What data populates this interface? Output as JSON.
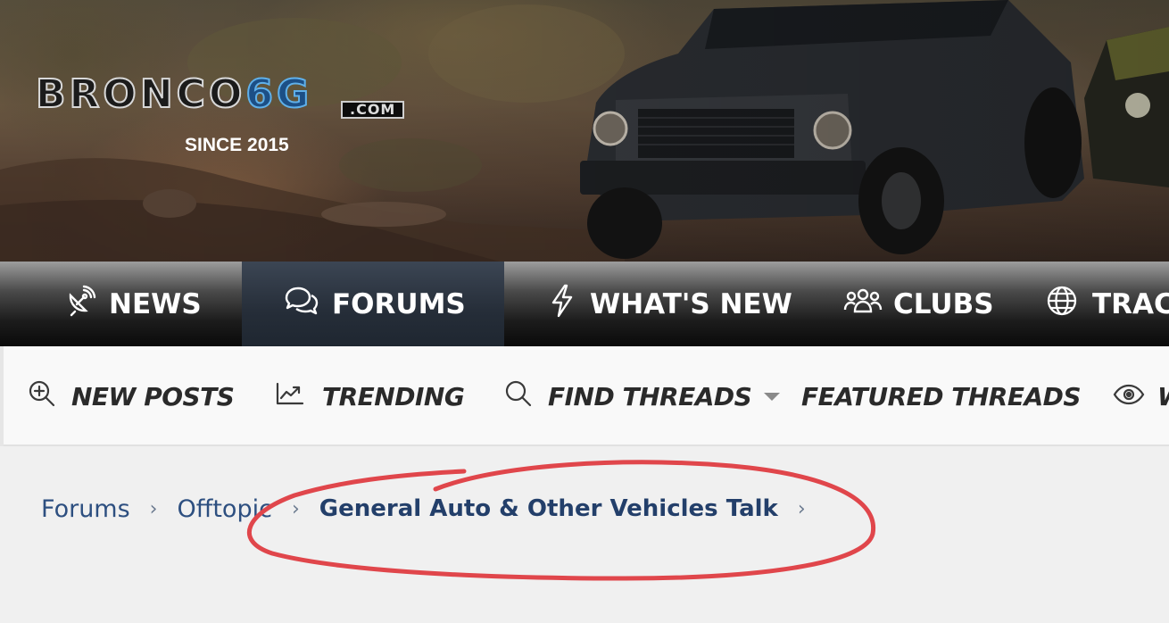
{
  "banner": {
    "logo_main": "BRONCO",
    "logo_six": "6G",
    "logo_com": ".COM",
    "tagline": "SINCE 2015"
  },
  "primary_nav": {
    "items": [
      {
        "label": "NEWS",
        "icon": "satellite-dish-icon",
        "active": false
      },
      {
        "label": "FORUMS",
        "icon": "chat-bubbles-icon",
        "active": true
      },
      {
        "label": "WHAT'S NEW",
        "icon": "lightning-bolt-icon",
        "active": false
      },
      {
        "label": "CLUBS",
        "icon": "users-group-icon",
        "active": false
      },
      {
        "label": "TRAC",
        "icon": "globe-icon",
        "active": false
      }
    ]
  },
  "secondary_nav": {
    "items": [
      {
        "label": "NEW POSTS",
        "icon": "zoom-plus-icon"
      },
      {
        "label": "TRENDING",
        "icon": "trending-chart-icon"
      },
      {
        "label": "FIND THREADS",
        "icon": "search-icon",
        "has_dropdown": true
      },
      {
        "label": "FEATURED THREADS",
        "icon": ""
      },
      {
        "label": "W",
        "icon": "eye-icon"
      }
    ]
  },
  "breadcrumb": {
    "items": [
      "Forums",
      "Offtopic",
      "General Auto & Other Vehicles Talk"
    ],
    "separator": "›"
  },
  "colors": {
    "annotation_red": "#e0464b",
    "link_blue": "#2d4f80",
    "active_tab": "#2a333f"
  }
}
